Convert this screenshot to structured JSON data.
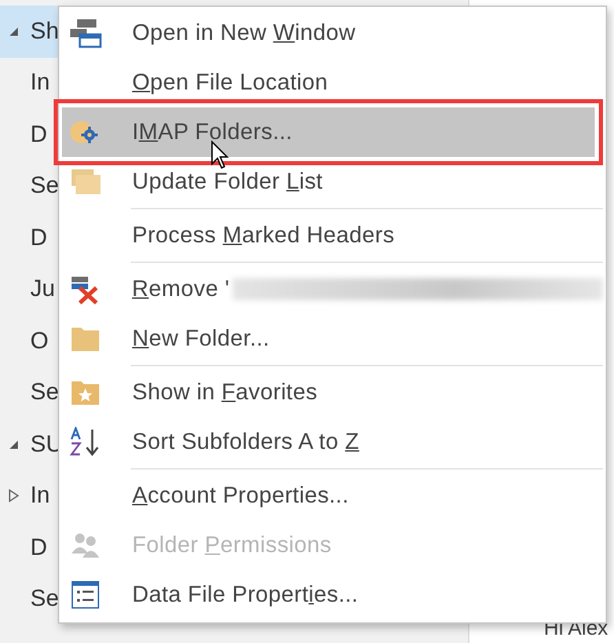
{
  "folder_pane": {
    "items": [
      {
        "label": "Sh",
        "expandable": true,
        "expanded": true,
        "selected": true
      },
      {
        "label": "In",
        "expandable": false,
        "selected": false
      },
      {
        "label": "D",
        "expandable": false,
        "selected": false
      },
      {
        "label": "Se",
        "expandable": false,
        "selected": false
      },
      {
        "label": "D",
        "expandable": false,
        "selected": false
      },
      {
        "label": "Ju",
        "expandable": false,
        "selected": false
      },
      {
        "label": "O",
        "expandable": false,
        "selected": false
      },
      {
        "label": "Se",
        "expandable": false,
        "selected": false
      },
      {
        "label": "SU",
        "expandable": true,
        "expanded": true,
        "selected": false
      },
      {
        "label": "In",
        "expandable": true,
        "expanded": false,
        "selected": false
      },
      {
        "label": "D",
        "expandable": false,
        "selected": false
      },
      {
        "label": "Se",
        "expandable": false,
        "selected": false
      }
    ]
  },
  "reading_pane": {
    "preview_text": "Hi Alex"
  },
  "context_menu": {
    "groups": [
      [
        {
          "before": "Open in New ",
          "key": "W",
          "after": "indow",
          "selected": false,
          "disabled": false,
          "redacted": false
        },
        {
          "key": "O",
          "after": "pen File Location",
          "selected": false,
          "disabled": false,
          "redacted": false
        },
        {
          "before": "I",
          "key": "M",
          "after": "AP Folders...",
          "selected": true,
          "disabled": false,
          "redacted": false
        },
        {
          "before": "Update Folder ",
          "key": "L",
          "after": "ist",
          "selected": false,
          "disabled": false,
          "redacted": false
        }
      ],
      [
        {
          "before": "Process ",
          "key": "M",
          "after": "arked Headers",
          "selected": false,
          "disabled": false,
          "redacted": false
        }
      ],
      [
        {
          "key": "R",
          "after": "emove '",
          "selected": false,
          "disabled": false,
          "redacted": true
        },
        {
          "key": "N",
          "after": "ew Folder...",
          "selected": false,
          "disabled": false,
          "redacted": false
        }
      ],
      [
        {
          "before": "Show in ",
          "key": "F",
          "after": "avorites",
          "selected": false,
          "disabled": false,
          "redacted": false
        },
        {
          "before": "Sort Subfolders A to ",
          "key": "Z",
          "selected": false,
          "disabled": false,
          "redacted": false
        }
      ],
      [
        {
          "key": "A",
          "after": "ccount Properties...",
          "selected": false,
          "disabled": false,
          "redacted": false
        },
        {
          "before": "Folder ",
          "key": "P",
          "after": "ermissions",
          "selected": false,
          "disabled": true,
          "redacted": false
        },
        {
          "before": "Data File Propert",
          "key": "i",
          "after": "es...",
          "selected": false,
          "disabled": false,
          "redacted": false
        }
      ]
    ]
  }
}
